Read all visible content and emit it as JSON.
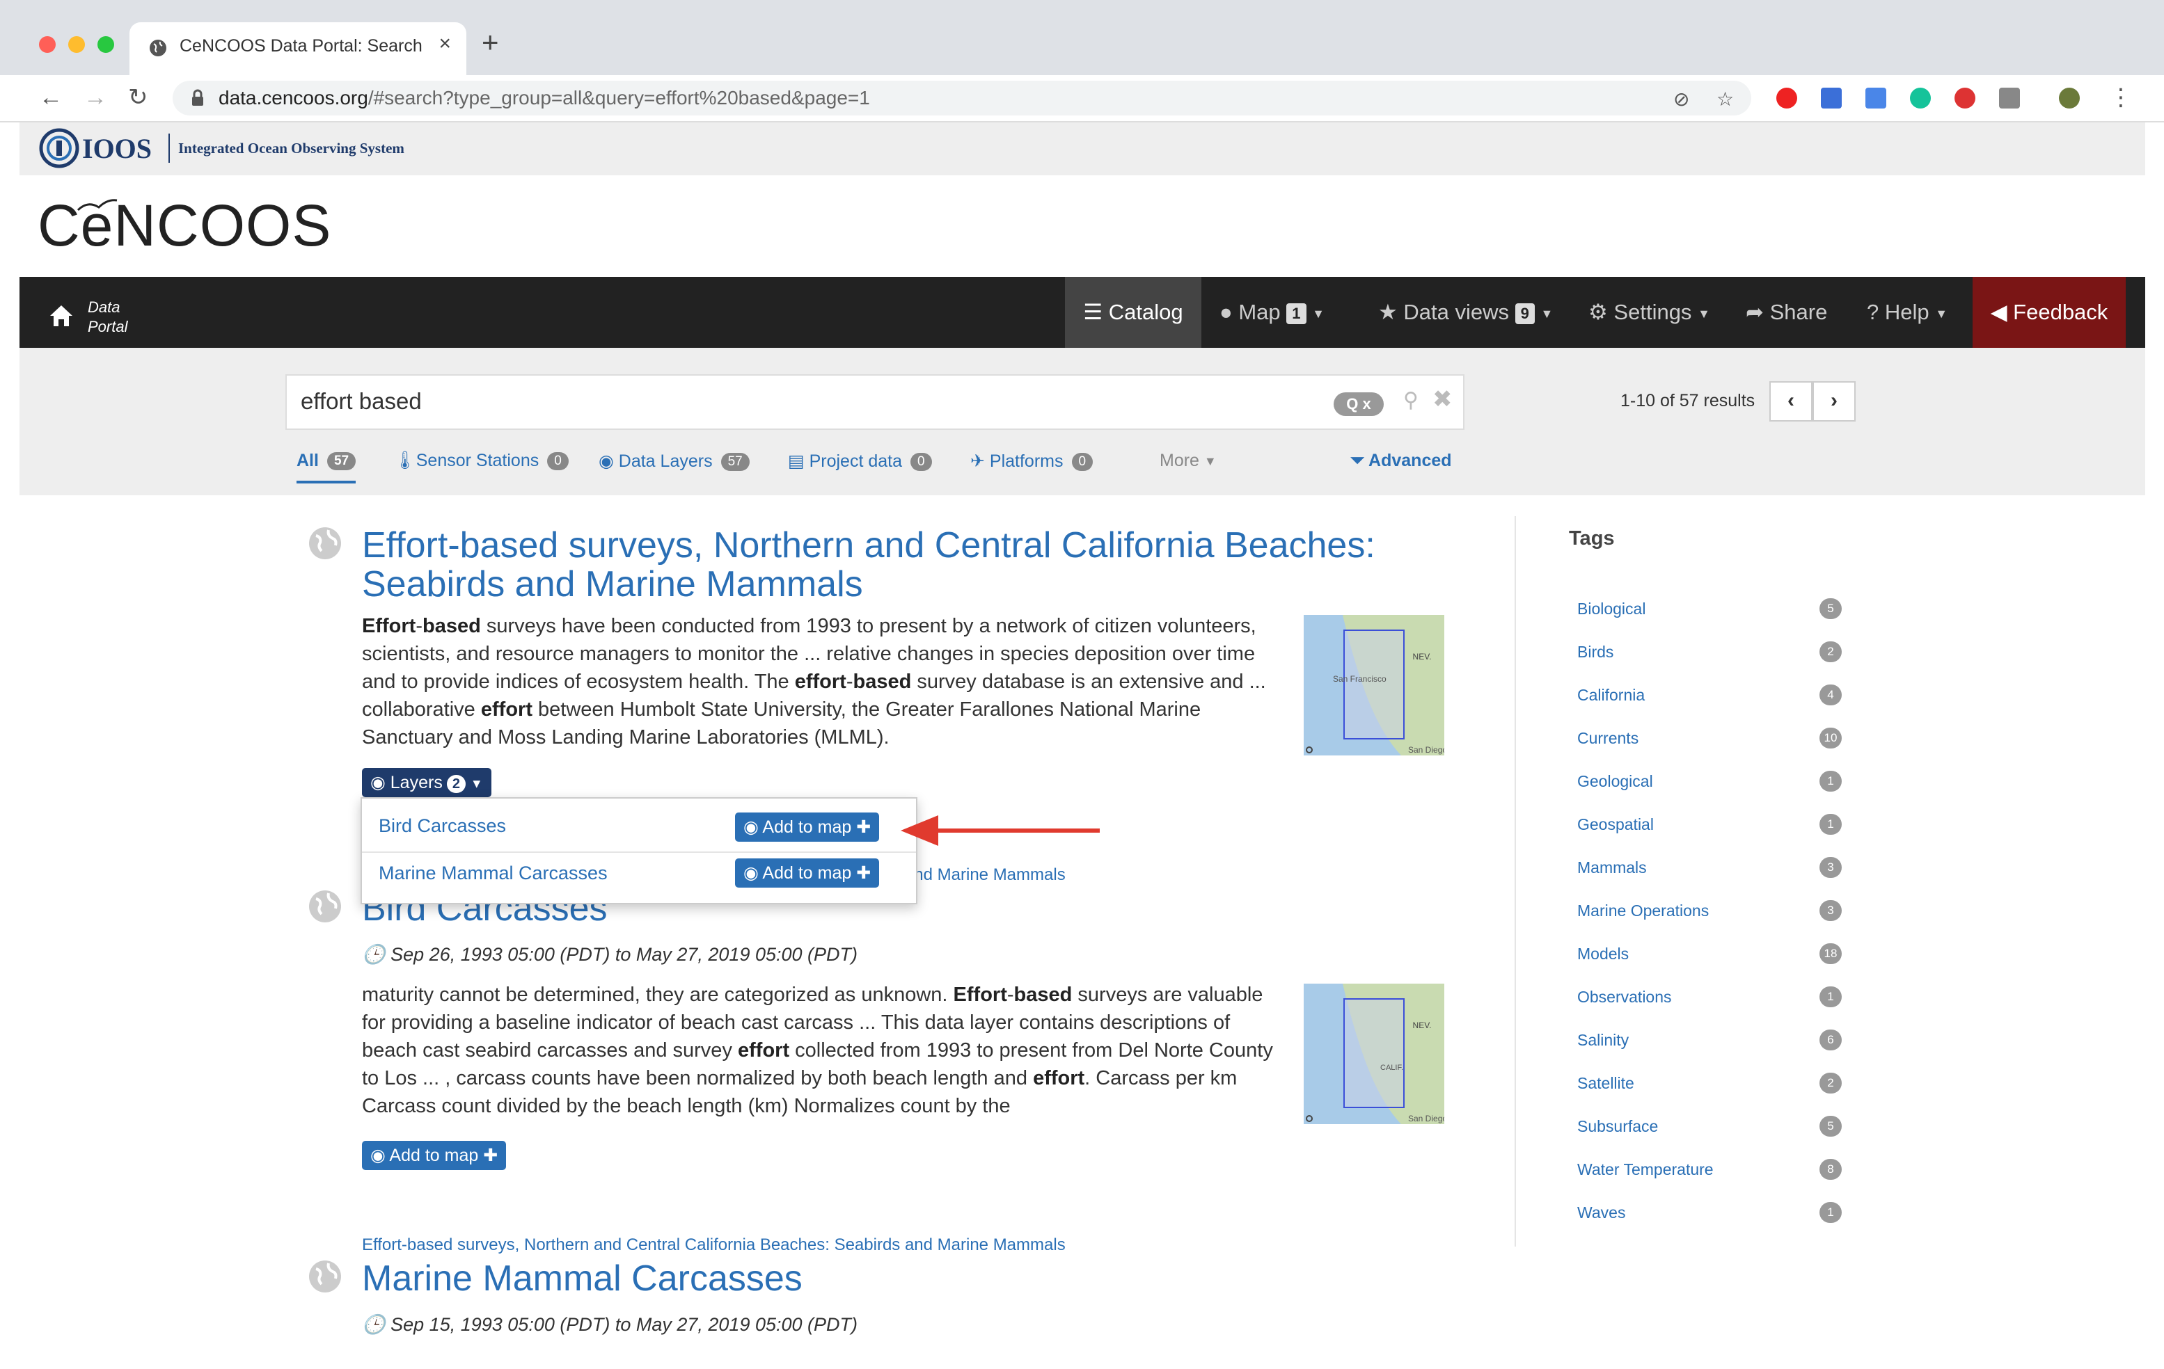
{
  "browser": {
    "tab_title": "CeNCOOS Data Portal: Search",
    "url_host": "data.cencoos.org",
    "url_rest": "/#search?type_group=all&query=effort%20based&page=1"
  },
  "header": {
    "ioos_name": "IOOS",
    "ioos_subtitle": "Integrated Ocean Observing System",
    "brand": "CeNCOOS"
  },
  "nav": {
    "home_label_1": "Data",
    "home_label_2": "Portal",
    "catalog": "Catalog",
    "map": "Map",
    "map_count": "1",
    "data_views": "Data views",
    "data_views_count": "9",
    "settings": "Settings",
    "share": "Share",
    "help": "Help",
    "feedback": "Feedback"
  },
  "search": {
    "query": "effort based",
    "results_text": "1-10 of 57 results",
    "tabs": [
      {
        "label": "All",
        "count": "57"
      },
      {
        "label": "Sensor Stations",
        "count": "0"
      },
      {
        "label": "Data Layers",
        "count": "57"
      },
      {
        "label": "Project data",
        "count": "0"
      },
      {
        "label": "Platforms",
        "count": "0"
      },
      {
        "label": "More"
      },
      {
        "label": "Advanced"
      }
    ]
  },
  "results": [
    {
      "title_line1": "Effort-based surveys, Northern and Central California Beaches:",
      "title_line2": "Seabirds and Marine Mammals",
      "layers_button": "Layers",
      "layers_count": "2",
      "dropdown": [
        {
          "label": "Bird Carcasses",
          "button": "Add to map"
        },
        {
          "label": "Marine Mammal Carcasses",
          "button": "Add to map"
        }
      ]
    },
    {
      "parent_link": "Effort-based surveys, Northern and Central California Beaches: Seabirds and Marine Mammals",
      "title": "Bird Carcasses",
      "date": "Sep 26, 1993 05:00 (PDT) to May 27, 2019 05:00 (PDT)",
      "button": "Add to map"
    },
    {
      "parent_link": "Effort-based surveys, Northern and Central California Beaches: Seabirds and Marine Mammals",
      "title": "Marine Mammal Carcasses",
      "date": "Sep 15, 1993 05:00 (PDT) to May 27, 2019 05:00 (PDT)"
    }
  ],
  "thumb_labels": {
    "state": "NEV.",
    "city": "San Francisco",
    "city2": "San Diego",
    "region": "CALIF."
  },
  "tags": {
    "heading": "Tags",
    "items": [
      {
        "name": "Biological",
        "count": "5"
      },
      {
        "name": "Birds",
        "count": "2"
      },
      {
        "name": "California",
        "count": "4"
      },
      {
        "name": "Currents",
        "count": "10"
      },
      {
        "name": "Geological",
        "count": "1"
      },
      {
        "name": "Geospatial",
        "count": "1"
      },
      {
        "name": "Mammals",
        "count": "3"
      },
      {
        "name": "Marine Operations",
        "count": "3"
      },
      {
        "name": "Models",
        "count": "18"
      },
      {
        "name": "Observations",
        "count": "1"
      },
      {
        "name": "Salinity",
        "count": "6"
      },
      {
        "name": "Satellite",
        "count": "2"
      },
      {
        "name": "Subsurface",
        "count": "5"
      },
      {
        "name": "Water Temperature",
        "count": "8"
      },
      {
        "name": "Waves",
        "count": "1"
      }
    ]
  },
  "colors": {
    "link": "#2a6fb5",
    "nav": "#222222",
    "feedback": "#7a1515",
    "arrow": "#e03a2e"
  }
}
